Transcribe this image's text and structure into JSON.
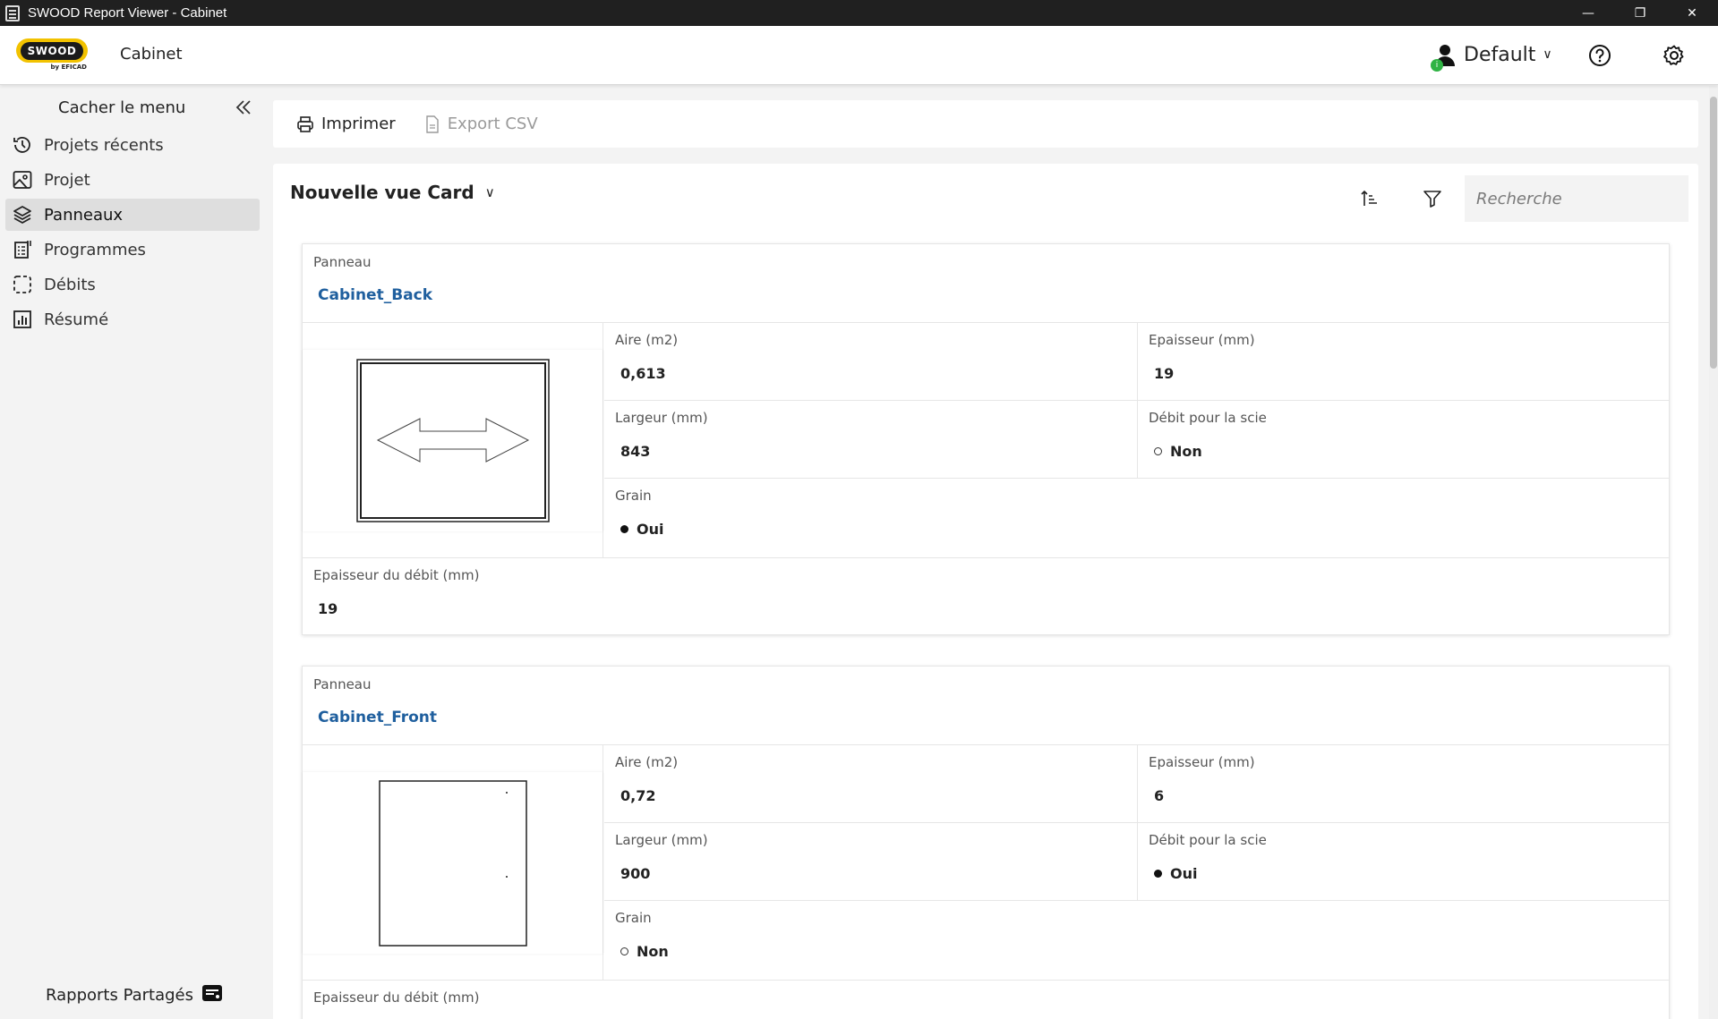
{
  "window": {
    "title": "SWOOD Report Viewer - Cabinet",
    "controls": [
      "minimize",
      "restore",
      "close"
    ]
  },
  "header": {
    "logo_text": "SWOOD",
    "logo_sub": "by EFICAD",
    "title": "Cabinet",
    "user": {
      "name": "Default",
      "notification_count": "i"
    },
    "icons": [
      "help-icon",
      "settings-icon"
    ]
  },
  "sidebar": {
    "hide_label": "Cacher le menu",
    "items": [
      {
        "label": "Projets récents",
        "icon": "history-icon",
        "active": false
      },
      {
        "label": "Projet",
        "icon": "image-icon",
        "active": false
      },
      {
        "label": "Panneaux",
        "icon": "layers-icon",
        "active": true
      },
      {
        "label": "Programmes",
        "icon": "program-icon",
        "active": false
      },
      {
        "label": "Débits",
        "icon": "dashed-square-icon",
        "active": false
      },
      {
        "label": "Résumé",
        "icon": "chart-icon",
        "active": false
      }
    ],
    "shared_reports": "Rapports Partagés"
  },
  "toolbar": {
    "print_label": "Imprimer",
    "export_label": "Export CSV"
  },
  "view": {
    "title": "Nouvelle vue Card",
    "search_placeholder": "Recherche"
  },
  "labels": {
    "panneau": "Panneau",
    "aire": "Aire (m2)",
    "epaisseur": "Epaisseur (mm)",
    "largeur": "Largeur (mm)",
    "debit_scie": "Débit pour la scie",
    "grain": "Grain",
    "epaisseur_debit": "Epaisseur du débit (mm)"
  },
  "cards": [
    {
      "panneau": "Cabinet_Back",
      "aire": "0,613",
      "epaisseur": "19",
      "largeur": "843",
      "debit_scie": "Non",
      "debit_scie_checked": false,
      "grain": "Oui",
      "grain_checked": true,
      "epaisseur_debit": "19"
    },
    {
      "panneau": "Cabinet_Front",
      "aire": "0,72",
      "epaisseur": "6",
      "largeur": "900",
      "debit_scie": "Oui",
      "debit_scie_checked": true,
      "grain": "Non",
      "grain_checked": false,
      "epaisseur_debit": ""
    }
  ],
  "colors": {
    "accent_link": "#1f5f9e",
    "logo_yellow": "#f2c200",
    "titlebar": "#202020",
    "notification_green": "#2fb344"
  }
}
